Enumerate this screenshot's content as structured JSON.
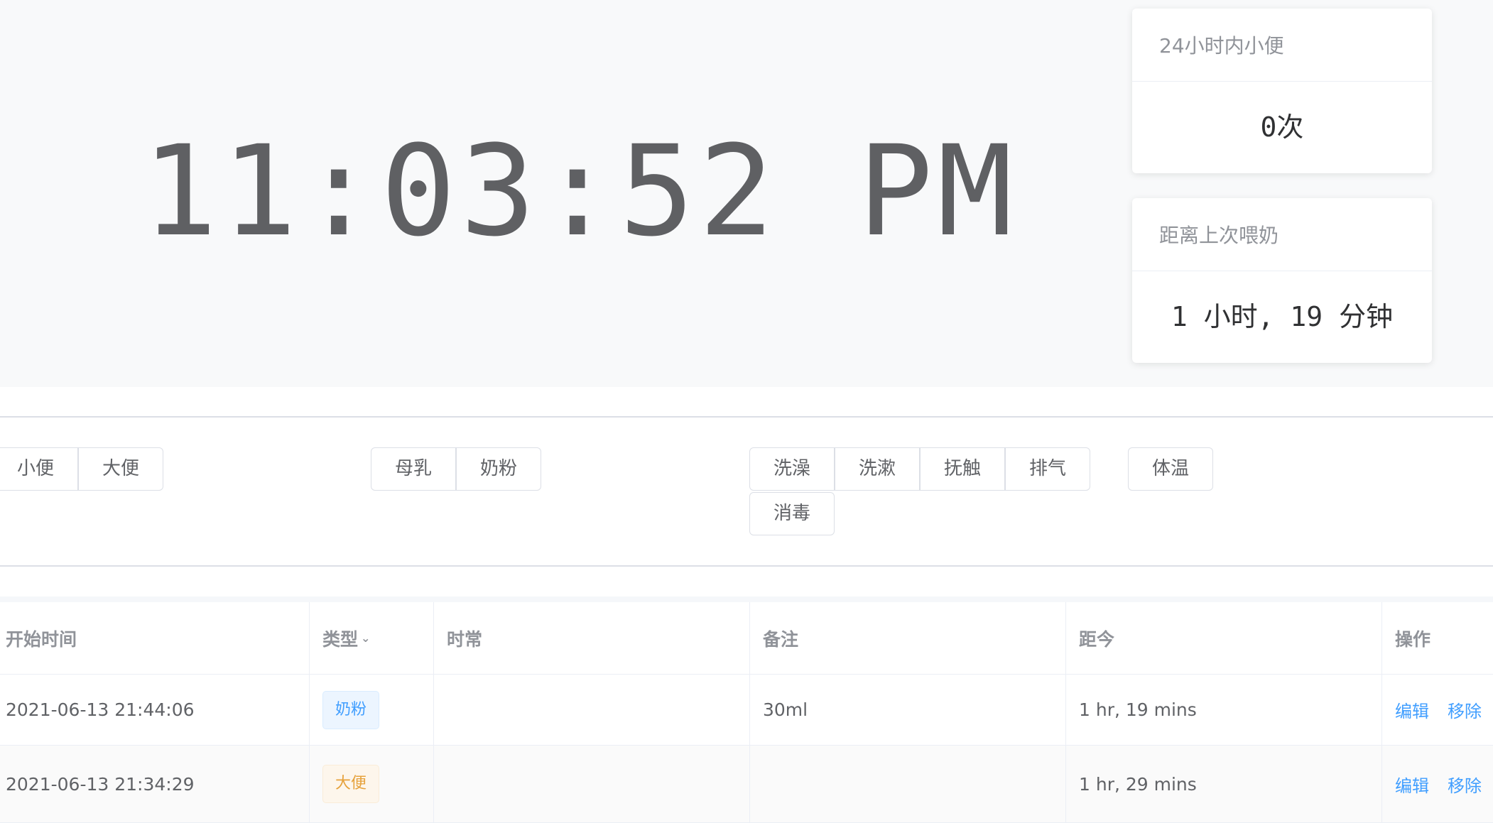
{
  "clock": {
    "time": "11:03:52 PM"
  },
  "cards": [
    {
      "title": "24小时内小便",
      "value": "0次"
    },
    {
      "title": "距离上次喂奶",
      "value": "1 小时, 19 分钟"
    }
  ],
  "buttons": {
    "excretion": [
      "小便",
      "大便"
    ],
    "feeding": [
      "母乳",
      "奶粉"
    ],
    "care": [
      "洗澡",
      "洗漱",
      "抚触",
      "排气",
      "消毒"
    ],
    "health": [
      "体温"
    ]
  },
  "table": {
    "headers": [
      "开始时间",
      "类型",
      "时常",
      "备注",
      "距今",
      "操作"
    ],
    "sort_icon": "chevron-down-icon",
    "rows": [
      {
        "start": "2021-06-13 21:44:06",
        "type": "奶粉",
        "type_color": "#409eff",
        "duration": "",
        "note": "30ml",
        "ago": "1 hr, 19 mins",
        "edit": "编辑",
        "remove": "移除"
      },
      {
        "start": "2021-06-13 21:34:29",
        "type": "大便",
        "type_color": "#e6a23c",
        "duration": "",
        "note": "",
        "ago": "1 hr, 29 mins",
        "edit": "编辑",
        "remove": "移除"
      }
    ]
  }
}
